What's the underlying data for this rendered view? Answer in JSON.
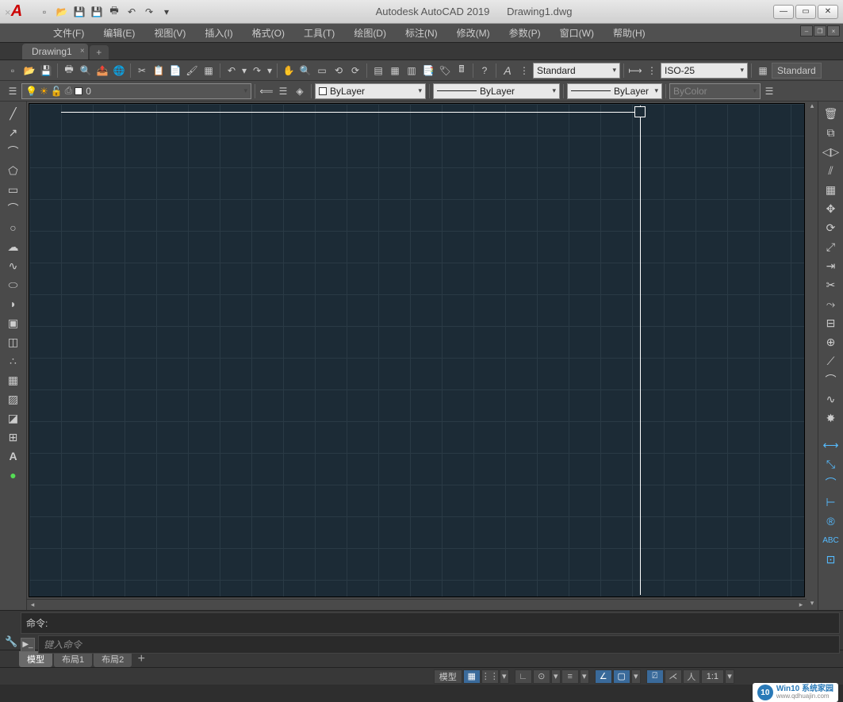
{
  "title": {
    "app": "Autodesk AutoCAD 2019",
    "file": "Drawing1.dwg"
  },
  "menu": [
    "文件(F)",
    "编辑(E)",
    "视图(V)",
    "插入(I)",
    "格式(O)",
    "工具(T)",
    "绘图(D)",
    "标注(N)",
    "修改(M)",
    "参数(P)",
    "窗口(W)",
    "帮助(H)"
  ],
  "doctab": {
    "name": "Drawing1"
  },
  "toolbar1": {
    "text_style": "Standard",
    "dim_style": "ISO-25",
    "table_style": "Standard"
  },
  "toolbar2": {
    "layer": "0",
    "color": "ByLayer",
    "linetype": "ByLayer",
    "lineweight": "ByLayer",
    "plotstyle": "ByColor"
  },
  "cmd": {
    "label": "命令:",
    "placeholder": "键入命令"
  },
  "layout_tabs": {
    "model": "模型",
    "layout1": "布局1",
    "layout2": "布局2"
  },
  "status": {
    "model": "模型",
    "scale": "1:1"
  },
  "watermark": {
    "logo": "10",
    "line1": "Win10 系统家园",
    "line2": "www.qdhuajin.com"
  }
}
